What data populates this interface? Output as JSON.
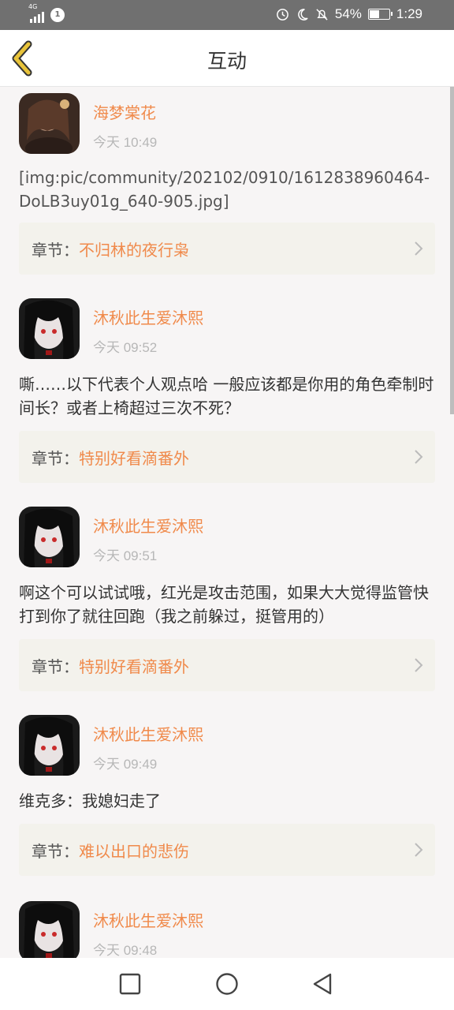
{
  "status_bar": {
    "network": "4G",
    "notification_badge": "1",
    "battery": "54%",
    "battery_level": 0.54,
    "time": "1:29"
  },
  "header": {
    "title": "互动",
    "back_icon": "chevron-left-icon"
  },
  "chapter_prefix": "章节：",
  "posts": [
    {
      "author": "海梦棠花",
      "time": "今天 10:49",
      "content": "[img:pic/community/202102/0910/1612838960464-DoLB3uy01g_640-905.jpg]",
      "chapter": "不归林的夜行枭"
    },
    {
      "author": "沐秋此生爱沐熙",
      "time": "今天 09:52",
      "content": "嘶……以下代表个人观点哈 一般应该都是你用的角色牵制时间长？或者上椅超过三次不死？",
      "chapter": "特别好看滴番外"
    },
    {
      "author": "沐秋此生爱沐熙",
      "time": "今天 09:51",
      "content": "啊这个可以试试哦，红光是攻击范围，如果大大觉得监管快打到你了就往回跑（我之前躲过，挺管用的）",
      "chapter": "特别好看滴番外"
    },
    {
      "author": "沐秋此生爱沐熙",
      "time": "今天 09:49",
      "content": "维克多：我媳妇走了",
      "chapter": "难以出口的悲伤"
    },
    {
      "author": "沐秋此生爱沐熙",
      "time": "今天 09:48"
    }
  ],
  "nav_bar": {
    "recents_icon": "square-icon",
    "home_icon": "circle-icon",
    "back_icon": "triangle-back-icon"
  },
  "colors": {
    "accent": "#f08a4b",
    "back_chevron": "#e8c33a",
    "chapter_bg": "#f3f2ec",
    "status_bar": "#707070"
  }
}
